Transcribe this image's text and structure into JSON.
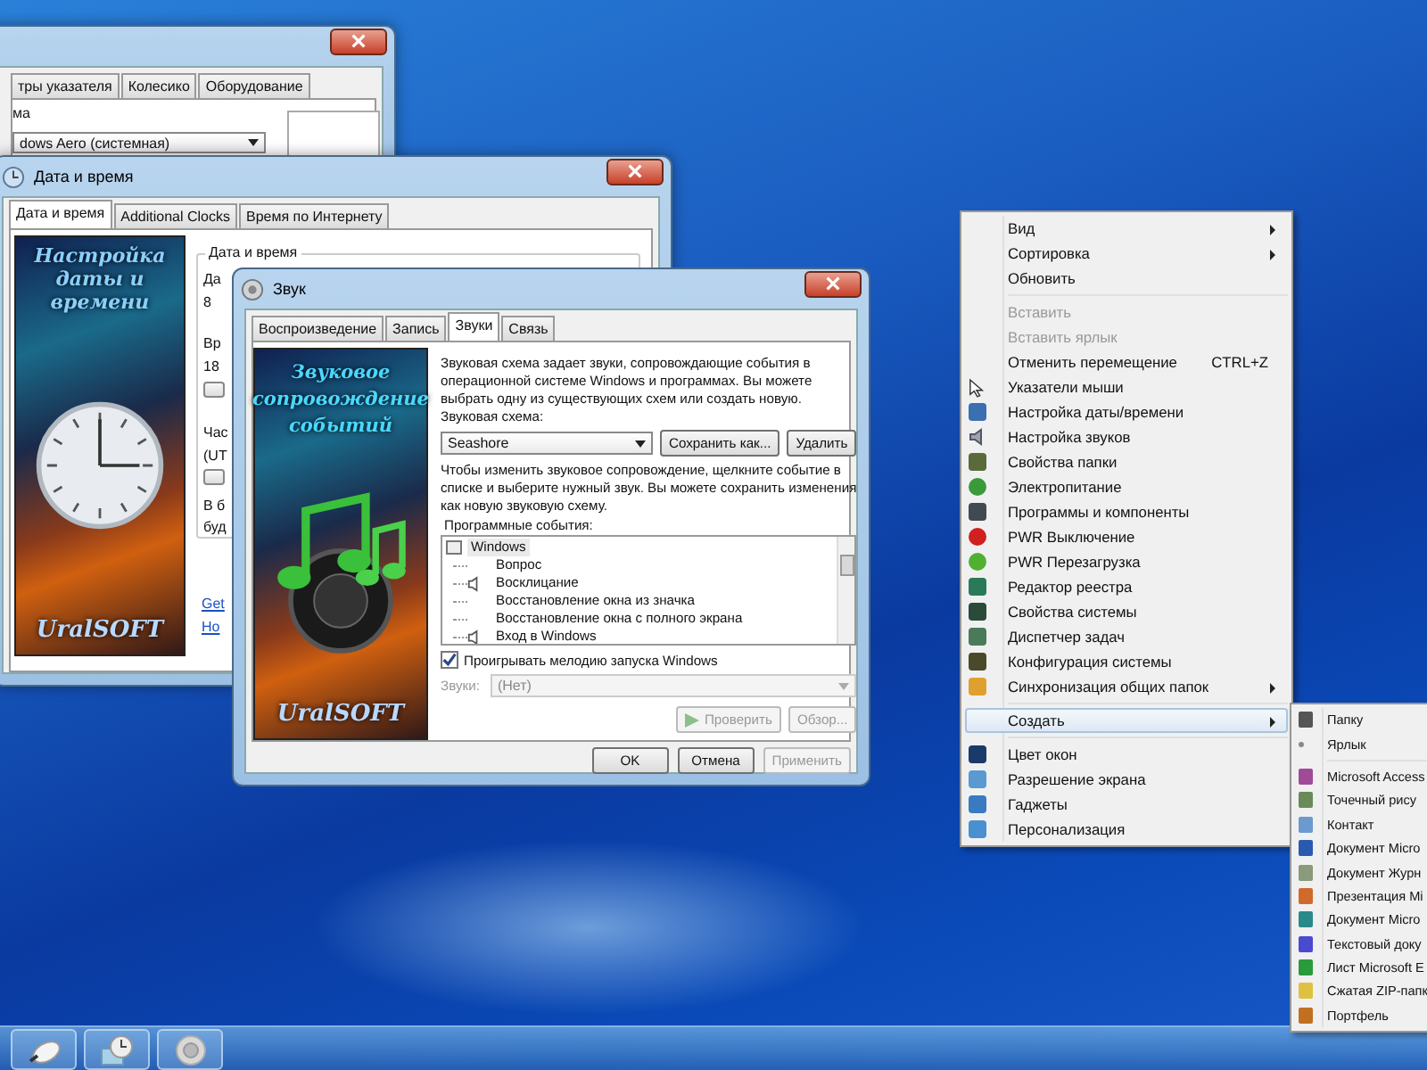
{
  "mouse_window": {
    "tabs": [
      {
        "label": "тры указателя",
        "selected": false
      },
      {
        "label": "Колесико",
        "selected": false
      },
      {
        "label": "Оборудование",
        "selected": false
      }
    ],
    "group_label": "ма",
    "scheme_value": "dows Aero (системная)"
  },
  "date_window": {
    "title": "Дата и время",
    "tabs": [
      {
        "label": "Дата и время",
        "selected": true
      },
      {
        "label": "Additional Clocks",
        "selected": false
      },
      {
        "label": "Время по Интернету",
        "selected": false
      }
    ],
    "banner": {
      "title": "Настройка даты и времени",
      "brand": "UralSOFT"
    },
    "group_label": "Дата и время",
    "fragments": [
      {
        "kind": "text",
        "text": "Да"
      },
      {
        "kind": "text",
        "text": "8"
      },
      {
        "kind": "text",
        "text": "Вр"
      },
      {
        "kind": "text",
        "text": "18"
      },
      {
        "kind": "button"
      },
      {
        "kind": "text",
        "text": "Час"
      },
      {
        "kind": "text",
        "text": "(UT"
      },
      {
        "kind": "button"
      },
      {
        "kind": "text",
        "text": "В б"
      },
      {
        "kind": "text",
        "text": "буд"
      }
    ],
    "links": [
      "Get",
      "Ho"
    ]
  },
  "sound_window": {
    "title": "Звук",
    "tabs": [
      {
        "label": "Воспроизведение",
        "selected": false
      },
      {
        "label": "Запись",
        "selected": false
      },
      {
        "label": "Звуки",
        "selected": true
      },
      {
        "label": "Связь",
        "selected": false
      }
    ],
    "banner": {
      "title": "Звуковое сопровождение событий",
      "brand": "UralSOFT"
    },
    "intro": "Звуковая схема задает звуки, сопровождающие события в операционной системе Windows и программах. Вы можете выбрать одну из существующих схем или создать новую.",
    "scheme_label": "Звуковая схема:",
    "scheme_value": "Seashore",
    "scheme_buttons": [
      {
        "label": "Сохранить как...",
        "disabled": false
      },
      {
        "label": "Удалить",
        "disabled": false
      }
    ],
    "hint": "Чтобы изменить звуковое сопровождение, щелкните событие в списке и выберите нужный звук. Вы можете сохранить изменения как новую звуковую схему.",
    "events_label": "Программные события:",
    "events": [
      {
        "label": "Windows",
        "selected": true,
        "children": [
          {
            "label": "Вопрос",
            "sound": false,
            "selected": false
          },
          {
            "label": "Восклицание",
            "sound": true,
            "selected": false
          },
          {
            "label": "Восстановление окна из значка",
            "sound": false,
            "selected": false
          },
          {
            "label": "Восстановление окна с полного экрана",
            "sound": false,
            "selected": false
          },
          {
            "label": "Вход в Windows",
            "sound": true,
            "selected": false
          }
        ]
      }
    ],
    "startup_sound": {
      "label": "Проигрывать мелодию запуска Windows",
      "checked": true
    },
    "sounds_label": "Звуки:",
    "sounds_value": "(Нет)",
    "sounds_disabled": true,
    "test_buttons": [
      {
        "label": "Проверить",
        "kind": "play",
        "disabled": true
      },
      {
        "label": "Обзор...",
        "kind": "plain",
        "disabled": true
      }
    ],
    "dialog_buttons": [
      {
        "label": "OK",
        "disabled": false
      },
      {
        "label": "Отмена",
        "disabled": false
      },
      {
        "label": "Применить",
        "disabled": true
      }
    ]
  },
  "context_menu": {
    "sections": [
      [
        {
          "label": "Вид",
          "disabled": false,
          "submenu": true,
          "selected": false
        },
        {
          "label": "Сортировка",
          "disabled": false,
          "submenu": true,
          "selected": false
        },
        {
          "label": "Обновить",
          "disabled": false,
          "submenu": false,
          "selected": false
        }
      ],
      [
        {
          "label": "Вставить",
          "disabled": true,
          "submenu": false,
          "selected": false
        },
        {
          "label": "Вставить ярлык",
          "disabled": true,
          "submenu": false,
          "selected": false
        },
        {
          "label": "Отменить перемещение",
          "shortcut": "CTRL+Z",
          "disabled": false,
          "submenu": false,
          "selected": false
        },
        {
          "label": "Указатели мыши",
          "disabled": false,
          "submenu": false,
          "selected": false
        },
        {
          "label": "Настройка даты/времени",
          "disabled": false,
          "submenu": false,
          "selected": false
        },
        {
          "label": "Настройка звуков",
          "disabled": false,
          "submenu": false,
          "selected": false
        },
        {
          "label": "Свойства папки",
          "disabled": false,
          "submenu": false,
          "selected": false
        },
        {
          "label": "Электропитание",
          "disabled": false,
          "submenu": false,
          "selected": false
        },
        {
          "label": "Программы и компоненты",
          "disabled": false,
          "submenu": false,
          "selected": false
        },
        {
          "label": "PWR Выключение",
          "disabled": false,
          "submenu": false,
          "selected": false
        },
        {
          "label": "PWR Перезагрузка",
          "disabled": false,
          "submenu": false,
          "selected": false
        },
        {
          "label": "Редактор реестра",
          "disabled": false,
          "submenu": false,
          "selected": false
        },
        {
          "label": "Свойства системы",
          "disabled": false,
          "submenu": false,
          "selected": false
        },
        {
          "label": "Диспетчер задач",
          "disabled": false,
          "submenu": false,
          "selected": false
        },
        {
          "label": "Конфигурация системы",
          "disabled": false,
          "submenu": false,
          "selected": false
        },
        {
          "label": "Синхронизация общих папок",
          "disabled": false,
          "submenu": true,
          "selected": false
        }
      ],
      [
        {
          "label": "Создать",
          "disabled": false,
          "submenu": true,
          "selected": true
        }
      ],
      [
        {
          "label": "Цвет окон",
          "disabled": false,
          "submenu": false,
          "selected": false
        },
        {
          "label": "Разрешение экрана",
          "disabled": false,
          "submenu": false,
          "selected": false
        },
        {
          "label": "Гаджеты",
          "disabled": false,
          "submenu": false,
          "selected": false
        },
        {
          "label": "Персонализация",
          "disabled": false,
          "submenu": false,
          "selected": false
        }
      ]
    ]
  },
  "create_submenu": {
    "sections": [
      [
        "Папку",
        "Ярлык"
      ],
      [
        "Microsoft Access",
        "Точечный рису",
        "Контакт",
        "Документ Micro",
        "Документ Журн",
        "Презентация Mi",
        "Документ Micro",
        "Текстовый доку",
        "Лист Microsoft E",
        "Сжатая ZIP-папк",
        "Портфель"
      ]
    ]
  }
}
